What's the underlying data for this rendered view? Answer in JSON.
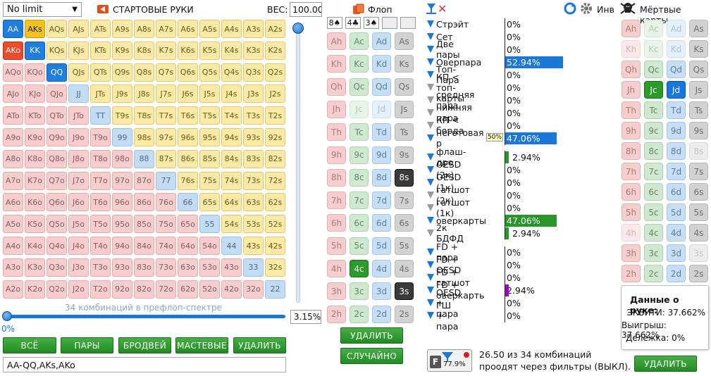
{
  "header": {
    "game": "No limit",
    "range_title": "СТАРТОВЫЕ РУКИ",
    "weight_label": "ВЕС:",
    "weight_value": "100.00",
    "flop_label": "Флоп",
    "inv_label": "Инв",
    "dead_label": "Мёртвые карты"
  },
  "grid": {
    "rows": [
      [
        "AA",
        "AKs",
        "AQs",
        "AJs",
        "ATs",
        "A9s",
        "A8s",
        "A7s",
        "A6s",
        "A5s",
        "A4s",
        "A3s",
        "A2s"
      ],
      [
        "AKo",
        "KK",
        "KQs",
        "KJs",
        "KTs",
        "K9s",
        "K8s",
        "K7s",
        "K6s",
        "K5s",
        "K4s",
        "K3s",
        "K2s"
      ],
      [
        "AQo",
        "KQo",
        "QQ",
        "QJs",
        "QTs",
        "Q9s",
        "Q8s",
        "Q7s",
        "Q6s",
        "Q5s",
        "Q4s",
        "Q3s",
        "Q2s"
      ],
      [
        "AJo",
        "KJo",
        "QJo",
        "JJ",
        "JTs",
        "J9s",
        "J8s",
        "J7s",
        "J6s",
        "J5s",
        "J4s",
        "J3s",
        "J2s"
      ],
      [
        "ATo",
        "KTo",
        "QTo",
        "JTo",
        "TT",
        "T9s",
        "T8s",
        "T7s",
        "T6s",
        "T5s",
        "T4s",
        "T3s",
        "T2s"
      ],
      [
        "A9o",
        "K9o",
        "Q9o",
        "J9o",
        "T9o",
        "99",
        "98s",
        "97s",
        "96s",
        "95s",
        "94s",
        "93s",
        "92s"
      ],
      [
        "A8o",
        "K8o",
        "Q8o",
        "J8o",
        "T8o",
        "98o",
        "88",
        "87s",
        "86s",
        "85s",
        "84s",
        "83s",
        "82s"
      ],
      [
        "A7o",
        "K7o",
        "Q7o",
        "J7o",
        "T7o",
        "97o",
        "87o",
        "77",
        "76s",
        "75s",
        "74s",
        "73s",
        "72s"
      ],
      [
        "A6o",
        "K6o",
        "Q6o",
        "J6o",
        "T6o",
        "96o",
        "86o",
        "76o",
        "66",
        "65s",
        "64s",
        "63s",
        "62s"
      ],
      [
        "A5o",
        "K5o",
        "Q5o",
        "J5o",
        "T5o",
        "95o",
        "85o",
        "75o",
        "65o",
        "55",
        "54s",
        "53s",
        "52s"
      ],
      [
        "A4o",
        "K4o",
        "Q4o",
        "J4o",
        "T4o",
        "94o",
        "84o",
        "74o",
        "64o",
        "54o",
        "44",
        "43s",
        "42s"
      ],
      [
        "A3o",
        "K3o",
        "Q3o",
        "J3o",
        "T3o",
        "93o",
        "83o",
        "73o",
        "63o",
        "53o",
        "43o",
        "33",
        "32s"
      ],
      [
        "A2o",
        "K2o",
        "Q2o",
        "J2o",
        "T2o",
        "92o",
        "82o",
        "72o",
        "62o",
        "52o",
        "42o",
        "32o",
        "22"
      ]
    ],
    "selected": [
      "AA",
      "AKs",
      "AKo",
      "KK",
      "QQ"
    ]
  },
  "slider": {
    "caption": "34 комбинаций в префлоп-спектре",
    "percent": "3.15%",
    "pct_left": "0%",
    "value": 0.0315
  },
  "buttons": {
    "all": "ВСЁ",
    "pairs": "ПАРЫ",
    "broadway": "БРОДВЕЙ",
    "suited": "МАСТЕВЫЕ",
    "delete": "УДАЛИТЬ",
    "flop_delete": "УДАЛИТЬ",
    "random": "СЛУЧАЙНО",
    "dead_delete": "УДАЛИТЬ"
  },
  "range_text": "AA-QQ,AKs,AKo",
  "board": {
    "cards": [
      "8♠",
      "4♣",
      "3♠",
      "",
      ""
    ]
  },
  "filters": [
    {
      "label": "Стрэйт",
      "pct": "0%",
      "on": true,
      "value": 0
    },
    {
      "label": "Сет",
      "pct": "0%",
      "on": true,
      "value": 0
    },
    {
      "label": "Две пары",
      "pct": "0%",
      "on": true,
      "value": 0
    },
    {
      "label": "Оверпара",
      "pct": "52.94%",
      "on": true,
      "value": 52.94
    },
    {
      "label": "Топ-Пара",
      "pct": "0%",
      "on": true,
      "value": 0
    },
    {
      "label": "КП < топ-карты",
      "pct": "0%",
      "on": false,
      "value": 0
    },
    {
      "label": "средняя пара",
      "pct": "0%",
      "on": false,
      "value": 0
    },
    {
      "label": "нижняя пара",
      "pct": "0%",
      "on": false,
      "value": 0
    },
    {
      "label": "КП < борда",
      "pct": "0%",
      "on": false,
      "value": 0
    },
    {
      "label": "неготовая р",
      "pct": "47.06%",
      "on": true,
      "value": 47.06,
      "tag": "50%"
    }
  ],
  "draws": [
    {
      "label": "флаш-дро",
      "pct": "2.94%",
      "on": true,
      "value": 2.94
    },
    {
      "label": "OESD (2к)",
      "pct": "0%",
      "on": true,
      "value": 0
    },
    {
      "label": "OESD (1к)",
      "pct": "0%",
      "on": true,
      "value": 0
    },
    {
      "label": "гатшот (2к)",
      "pct": "0%",
      "on": false,
      "value": 0
    },
    {
      "label": "гатшот (1к)",
      "pct": "0%",
      "on": false,
      "value": 0
    },
    {
      "label": "оверкарты",
      "pct": "47.06%",
      "on": true,
      "value": 47.06
    },
    {
      "label": "2к БДФД",
      "pct": "2.94%",
      "on": false,
      "value": 2.94
    }
  ],
  "combos": [
    {
      "label": "FD + пара",
      "pct": "0%",
      "on": true
    },
    {
      "label": "FD + OESD",
      "pct": "0%",
      "on": true
    },
    {
      "label": "FD + гатшот",
      "pct": "0%",
      "on": true
    },
    {
      "label": "FD + оверкарть",
      "pct": "2.94%",
      "on": true
    },
    {
      "label": "OESD + пара",
      "pct": "0%",
      "on": true
    },
    {
      "label": "ГШ + пара",
      "pct": "0%",
      "on": true
    }
  ],
  "hand_info": {
    "title": "Данные о руке:",
    "equity": "ЭКВИТИ: 37.662%",
    "win": "Выигрыш: 37.662%",
    "tie": "Делёжка: 0%"
  },
  "footer": {
    "status_line1": "26.50 из 34 комбинаций",
    "status_line2": "проодят через фильтры (ВЫКЛ).",
    "filter_pct": "77.9%",
    "filter_letter": "F"
  },
  "colors": {
    "accent_blue": "#1e7fde",
    "accent_green": "#2a952a",
    "suited": "#fbe9a6",
    "offsuit": "#f7cdcd",
    "pair": "#c2dcf3",
    "purple": "#a000c8"
  }
}
